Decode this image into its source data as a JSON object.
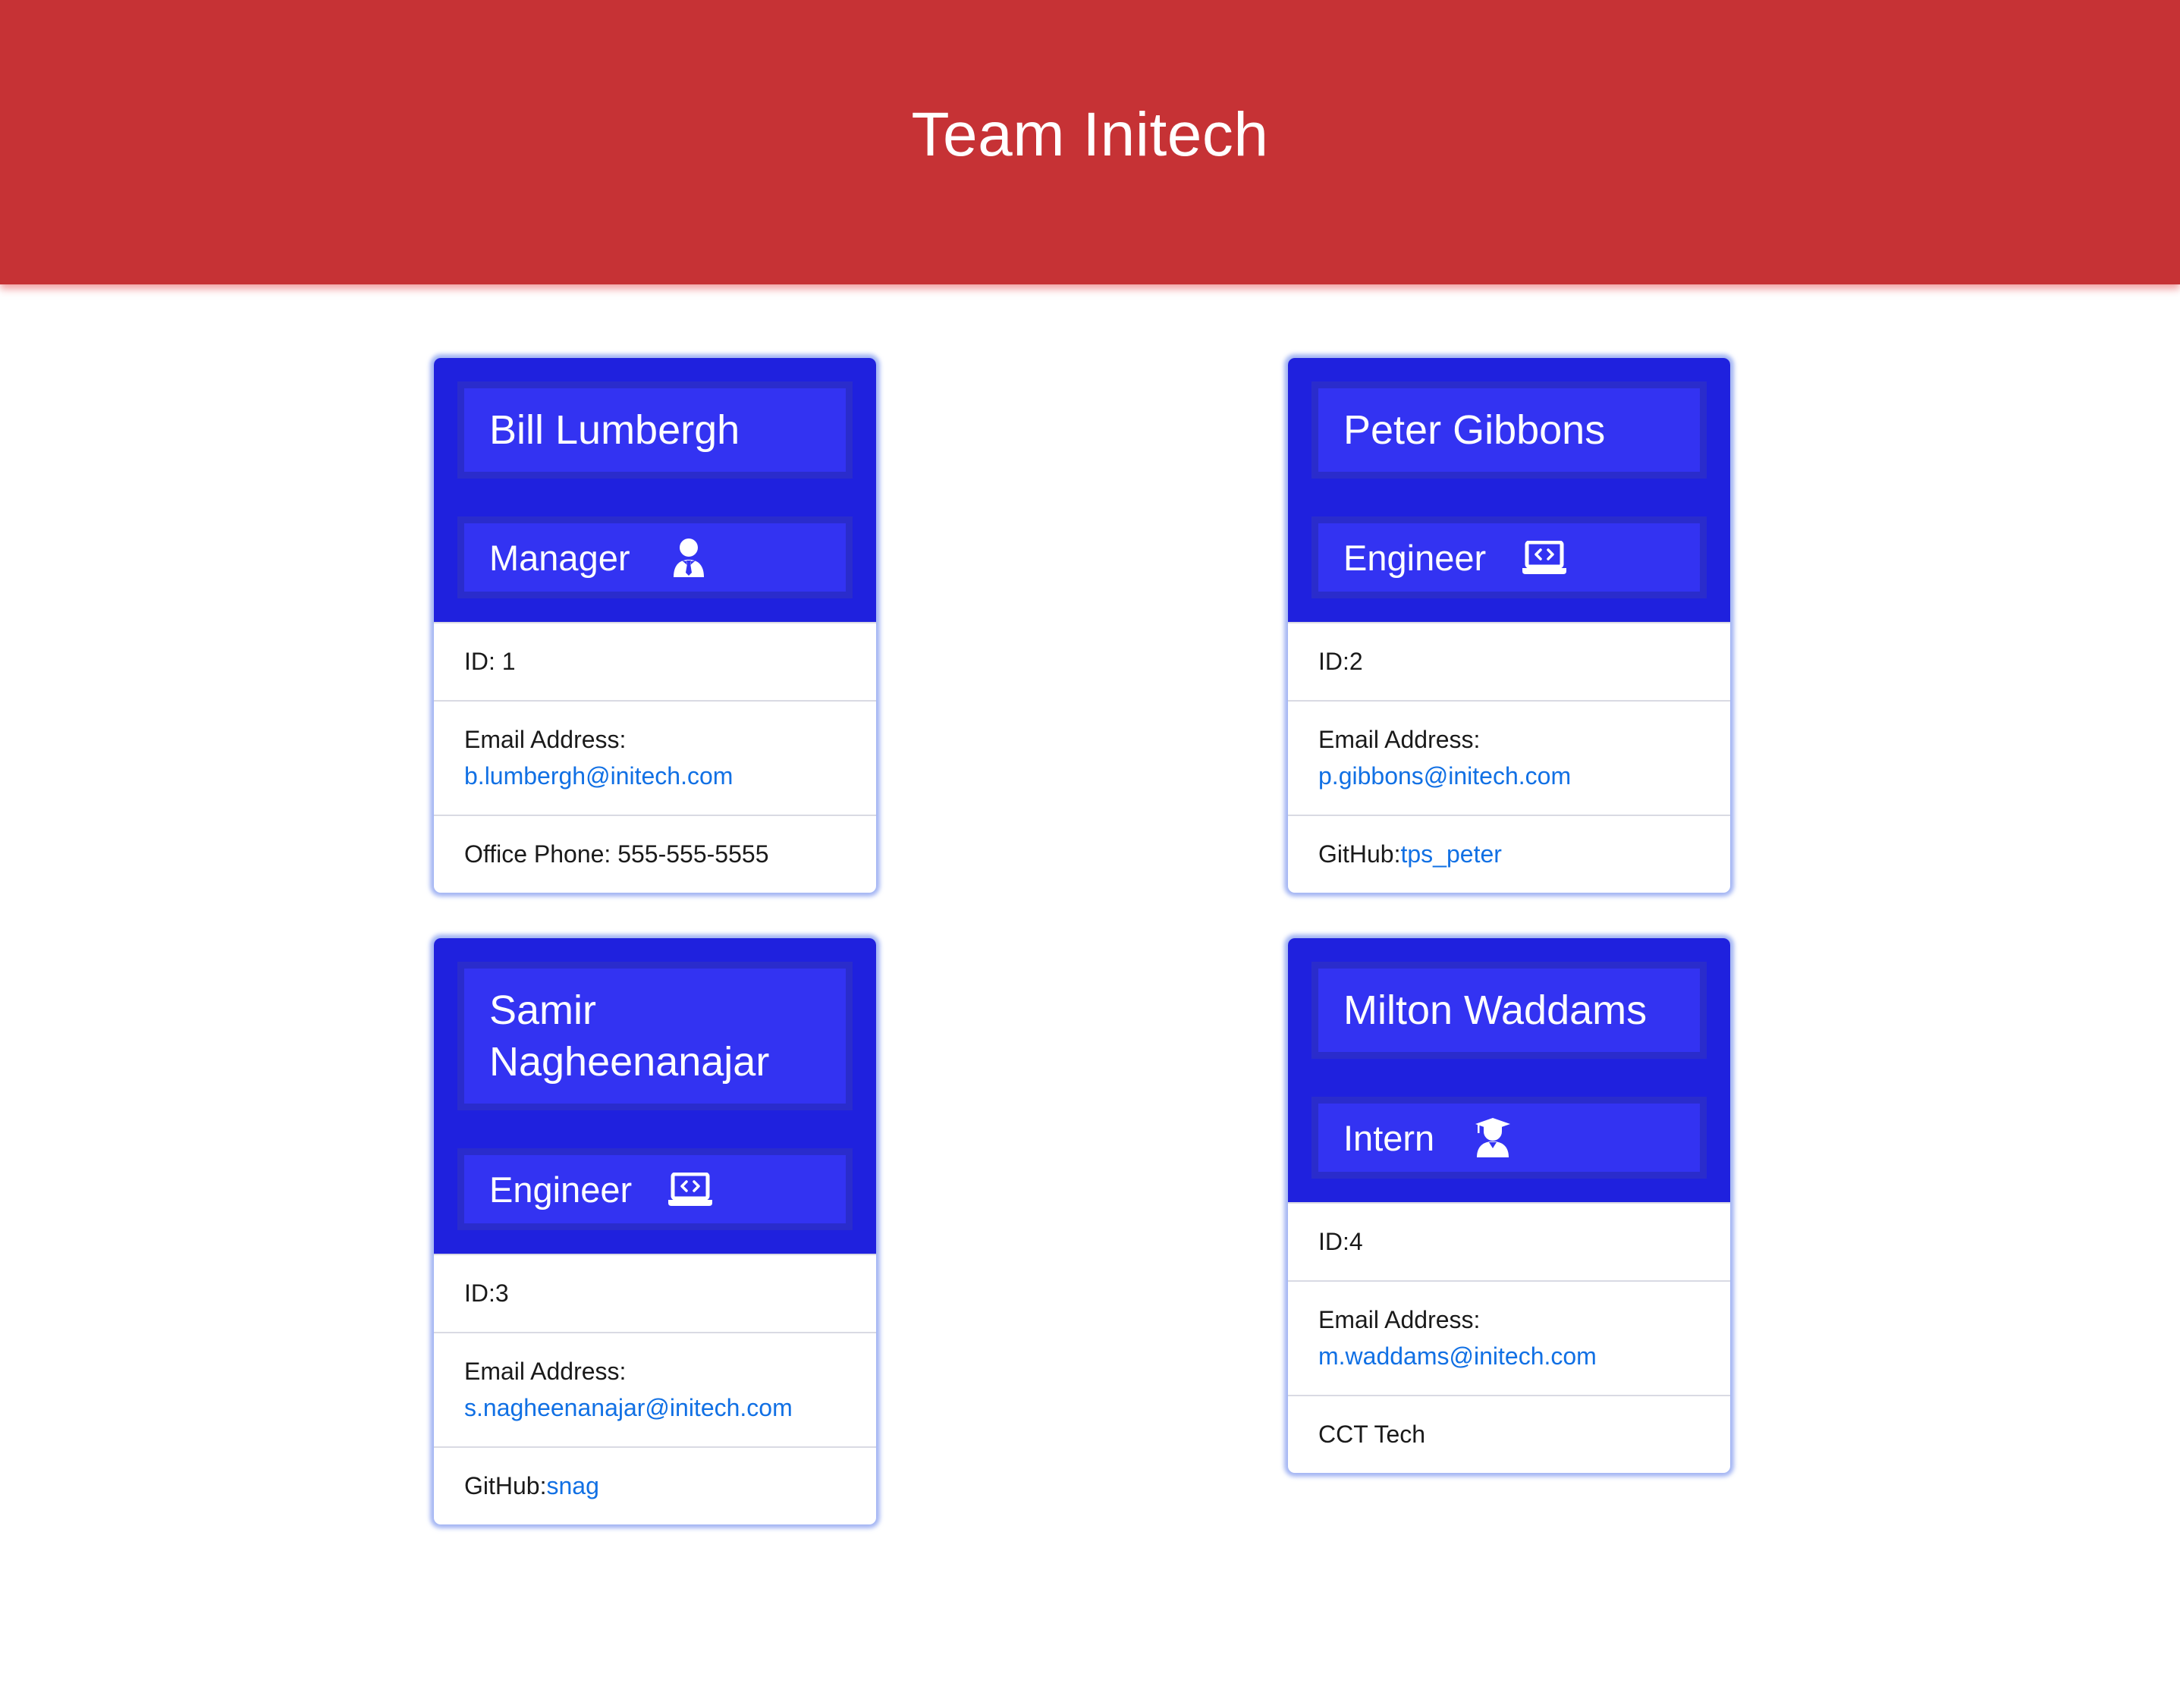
{
  "header": {
    "title": "Team Initech"
  },
  "colors": {
    "header_bg": "#c63235",
    "card_header_bg": "#1f21de",
    "title_box_bg": "#3333f2",
    "link": "#1170e4"
  },
  "employees": [
    {
      "name": "Bill Lumbergh",
      "role": "Manager",
      "role_icon": "user-tie-icon",
      "id_text": "ID: 1",
      "email_label": "Email Address:",
      "email": "b.lumbergh@initech.com",
      "extra_label": "Office Phone: 555-555-5555",
      "extra_link": ""
    },
    {
      "name": "Peter Gibbons",
      "role": "Engineer",
      "role_icon": "laptop-code-icon",
      "id_text": "ID:2",
      "email_label": "Email Address:",
      "email": "p.gibbons@initech.com",
      "extra_label": "GitHub:",
      "extra_link": "tps_peter"
    },
    {
      "name": "Samir Nagheenanajar",
      "role": "Engineer",
      "role_icon": "laptop-code-icon",
      "id_text": "ID:3",
      "email_label": "Email Address:",
      "email": "s.nagheenanajar@initech.com",
      "extra_label": "GitHub:",
      "extra_link": "snag"
    },
    {
      "name": "Milton Waddams",
      "role": "Intern",
      "role_icon": "user-graduate-icon",
      "id_text": "ID:4",
      "email_label": "Email Address:",
      "email": "m.waddams@initech.com",
      "extra_label": "CCT Tech",
      "extra_link": ""
    }
  ]
}
